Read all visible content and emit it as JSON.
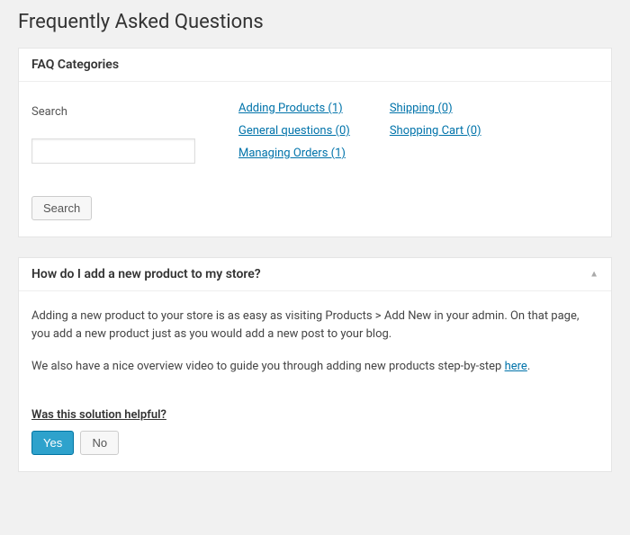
{
  "page_title": "Frequently Asked Questions",
  "categories_panel": {
    "header": "FAQ Categories",
    "search_label": "Search",
    "search_button": "Search"
  },
  "categories_col1": [
    "Adding Products (1)",
    "General questions (0)",
    "Managing Orders (1)"
  ],
  "categories_col2": [
    "Shipping (0)",
    "Shopping Cart (0)"
  ],
  "faq_item": {
    "question": "How do I add a new product to my store?",
    "answer_p1": "Adding a new product to your store is as easy as visiting Products > Add New in your admin. On that page, you add a new product just as you would add a new post to your blog.",
    "answer_p2_prefix": "We also have a nice overview video to guide you through adding new products step-by-step ",
    "answer_p2_link": "here",
    "answer_p2_suffix": "."
  },
  "helpful": {
    "question": "Was this solution helpful?",
    "yes": "Yes",
    "no": "No"
  }
}
